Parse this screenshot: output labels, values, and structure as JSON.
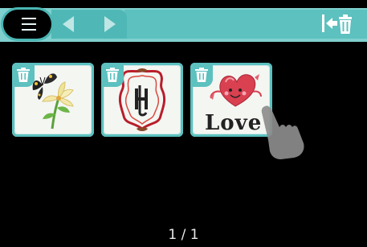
{
  "toolbar": {
    "menu_icon": "hamburger-menu-icon",
    "prev_icon": "arrow-left-icon",
    "next_icon": "arrow-right-icon",
    "delete_all_icon": "delete-all-icon"
  },
  "patterns": [
    {
      "name": "butterfly-lily",
      "thumbnail_icon": "butterfly-lily-icon",
      "delete_icon": "trash-icon"
    },
    {
      "name": "monogram-frame",
      "thumbnail_icon": "monogram-frame-icon",
      "delete_icon": "trash-icon"
    },
    {
      "name": "love-heart",
      "thumbnail_icon": "love-heart-icon",
      "delete_icon": "trash-icon",
      "label": "Love"
    }
  ],
  "pagination": {
    "text": "1 / 1"
  },
  "colors": {
    "topbar": "#7fd0ce",
    "accent": "#5cc1bf",
    "background": "#000000",
    "card_border": "#5cc1bf",
    "card_fill": "#f4f6f2"
  }
}
